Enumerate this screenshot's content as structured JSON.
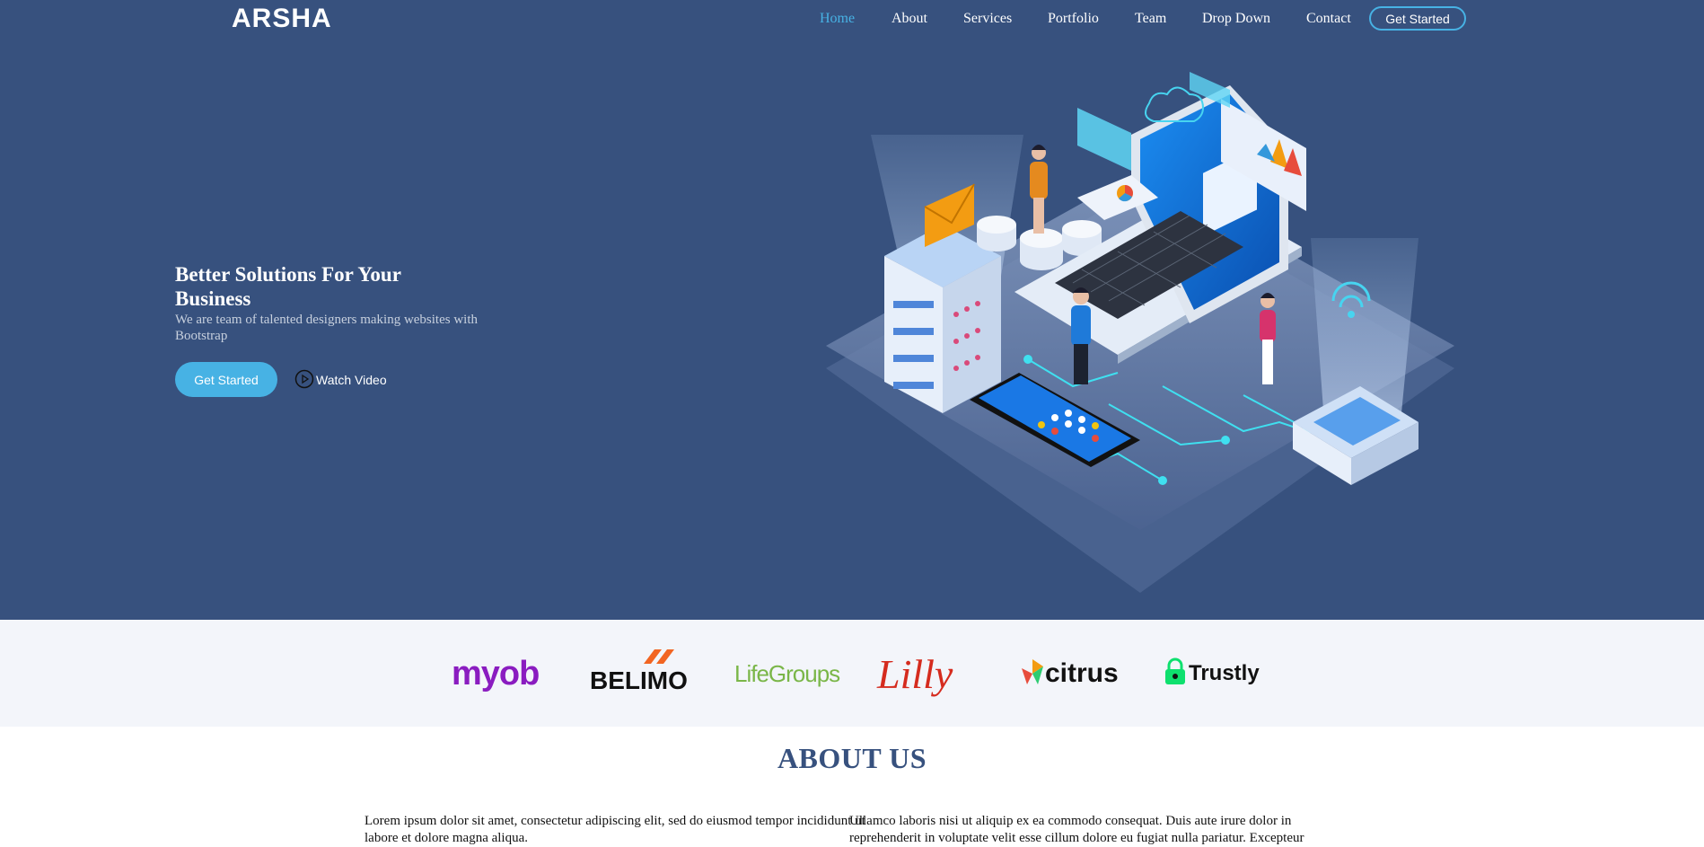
{
  "header": {
    "logo": "ARSHA",
    "nav": [
      {
        "label": "Home",
        "active": true
      },
      {
        "label": "About"
      },
      {
        "label": "Services"
      },
      {
        "label": "Portfolio"
      },
      {
        "label": "Team"
      },
      {
        "label": "Drop Down"
      },
      {
        "label": "Contact"
      }
    ],
    "cta_label": "Get Started"
  },
  "hero": {
    "title": "Better Solutions For Your Business",
    "subtitle": "We are team of talented designers making websites with Bootstrap",
    "get_started_label": "Get Started",
    "watch_video_label": "Watch Video",
    "illustration_icon": "isometric-tech-illustration"
  },
  "clients": {
    "logos": [
      {
        "name": "myob",
        "color": "#8a1cc0"
      },
      {
        "name": "BELIMO",
        "color": "#111111"
      },
      {
        "name": "LifeGroups",
        "color": "#7ab648"
      },
      {
        "name": "Lilly",
        "color": "#d52b1e"
      },
      {
        "name": "citrus",
        "color": "#111111"
      },
      {
        "name": "Trustly",
        "color": "#0ee06e"
      }
    ]
  },
  "about": {
    "title": "ABOUT US",
    "col1": "Lorem ipsum dolor sit amet, consectetur adipiscing elit, sed do eiusmod tempor incididunt ut labore et dolore magna aliqua.",
    "col2": "Ullamco laboris nisi ut aliquip ex ea commodo consequat. Duis aute irure dolor in reprehenderit in voluptate velit esse cillum dolore eu fugiat nulla pariatur. Excepteur"
  },
  "colors": {
    "hero_bg": "#37517e",
    "accent": "#47b2e4",
    "clients_bg": "#f3f5fa"
  }
}
